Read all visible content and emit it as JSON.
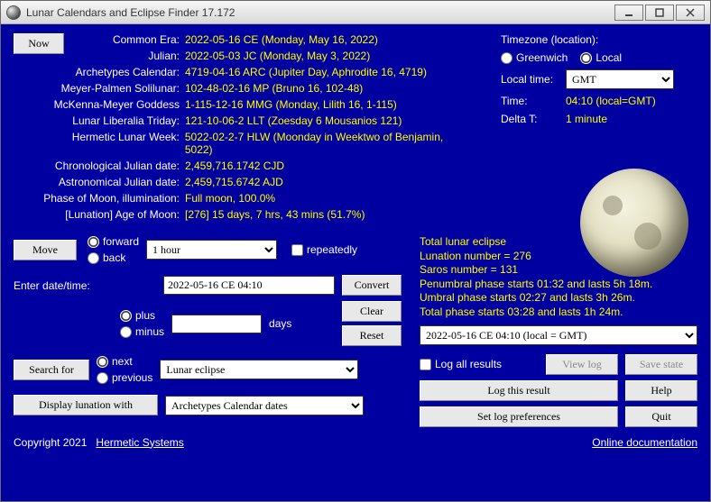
{
  "window": {
    "title": "Lunar Calendars and Eclipse Finder 17.172"
  },
  "now_button": "Now",
  "dates": {
    "common_era": {
      "label": "Common Era:",
      "value": "2022-05-16 CE (Monday, May 16, 2022)"
    },
    "julian": {
      "label": "Julian:",
      "value": "2022-05-03 JC (Monday, May 3, 2022)"
    },
    "archetypes": {
      "label": "Archetypes Calendar:",
      "value": "4719-04-16 ARC (Jupiter Day, Aphrodite 16,  4719)"
    },
    "meyer_palmen": {
      "label": "Meyer-Palmen Solilunar:",
      "value": "102-48-02-16 MP (Bruno 16, 102-48)"
    },
    "mckenna_meyer": {
      "label": "McKenna-Meyer Goddess",
      "value": "1-115-12-16 MMG (Monday, Lilith 16, 1-115)"
    },
    "liberalia": {
      "label": "Lunar Liberalia Triday:",
      "value": "121-10-06-2 LLT (Zoesday 6 Mousanios 121)"
    },
    "hermetic": {
      "label": "Hermetic Lunar Week:",
      "value": "5022-02-2-7 HLW (Moonday in Weektwo of Benjamin, 5022)"
    },
    "chrono_jd": {
      "label": "Chronological Julian date:",
      "value": "2,459,716.1742 CJD"
    },
    "astro_jd": {
      "label": "Astronomical Julian date:",
      "value": "2,459,715.6742 AJD"
    },
    "phase": {
      "label": "Phase of Moon, illumination:",
      "value": "Full moon, 100.0%"
    },
    "age": {
      "label": "[Lunation] Age of Moon:",
      "value": "[276] 15 days, 7 hrs, 43 mins (51.7%)"
    }
  },
  "timezone": {
    "heading": "Timezone (location):",
    "greenwich": "Greenwich",
    "local": "Local",
    "local_time_label": "Local time:",
    "local_time_value": "GMT",
    "time_label": "Time:",
    "time_value": "04:10 (local=GMT)",
    "delta_label": "Delta T:",
    "delta_value": "1 minute"
  },
  "move": {
    "button": "Move",
    "forward": "forward",
    "back": "back",
    "step": "1 hour",
    "repeatedly": "repeatedly"
  },
  "enter": {
    "label": "Enter date/time:",
    "value": "2022-05-16 CE 04:10",
    "plus": "plus",
    "minus": "minus",
    "days": "days",
    "offset": "",
    "convert": "Convert",
    "clear": "Clear",
    "reset": "Reset"
  },
  "search": {
    "button": "Search for",
    "next": "next",
    "previous": "previous",
    "target": "Lunar eclipse"
  },
  "display_lunation": {
    "button": "Display lunation with",
    "value": "Archetypes Calendar dates"
  },
  "eclipse": {
    "l1": "Total lunar eclipse",
    "l2": "Lunation number = 276",
    "l3": "Saros number = 131",
    "l4": "Penumbral phase starts 01:32 and lasts 5h 18m.",
    "l5": "Umbral phase starts 02:27 and lasts 3h 26m.",
    "l6": "Total phase starts 03:28 and lasts 1h 24m.",
    "selected": "2022-05-16 CE 04:10 (local = GMT)"
  },
  "log": {
    "log_all": "Log all results",
    "view": "View log",
    "save_state": "Save state",
    "log_this": "Log this result",
    "help": "Help",
    "set_prefs": "Set log preferences",
    "quit": "Quit"
  },
  "footer": {
    "copyright": "Copyright 2021",
    "company": "Hermetic Systems",
    "docs": "Online documentation"
  }
}
